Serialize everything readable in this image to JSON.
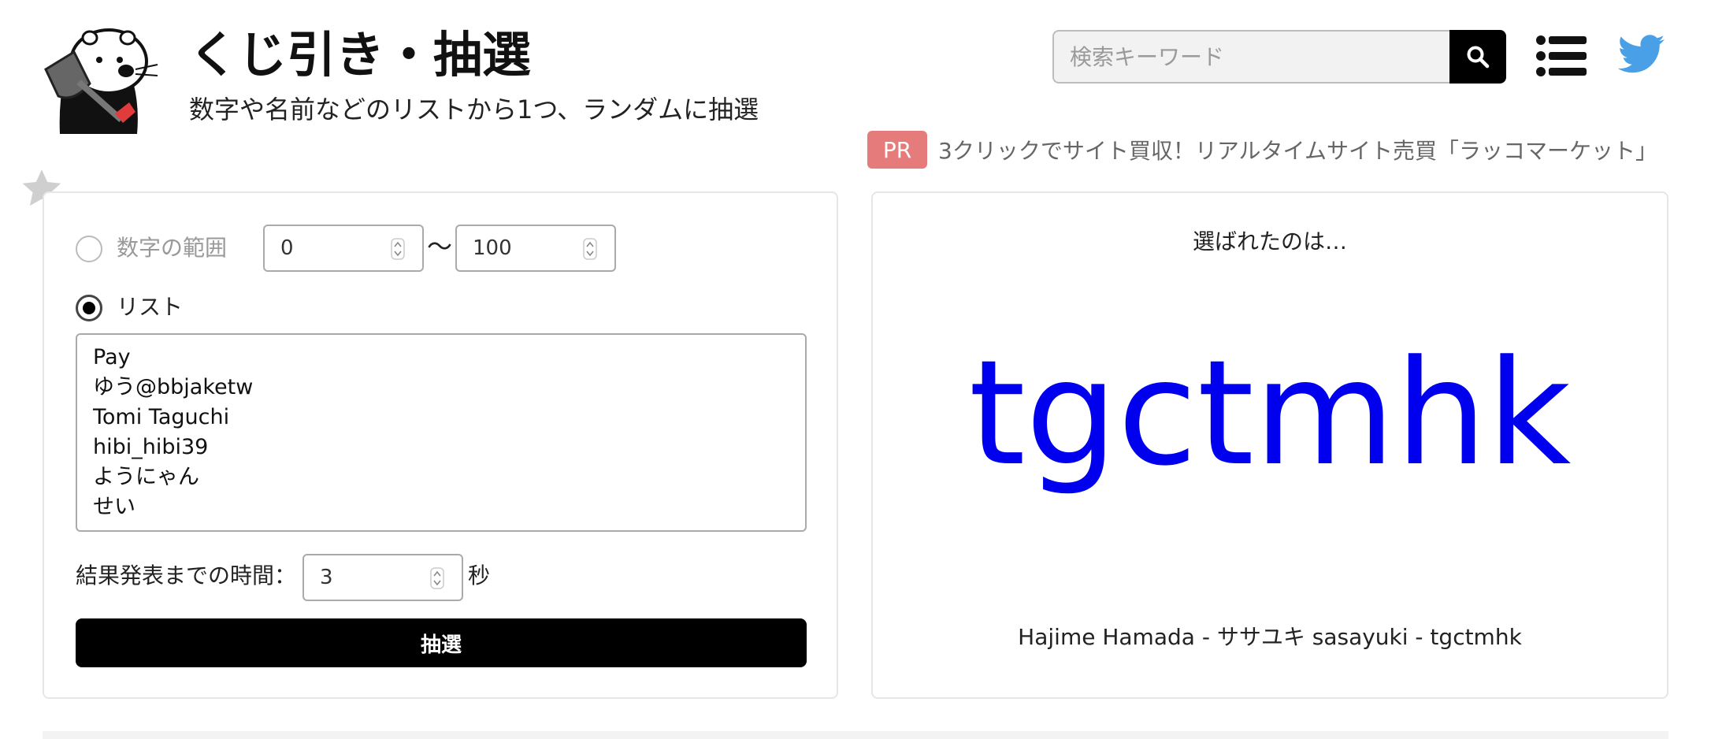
{
  "header": {
    "title": "くじ引き・抽選",
    "subtitle": "数字や名前などのリストから1つ、ランダムに抽選",
    "logo_icon": "otter-with-shovel-logo"
  },
  "search": {
    "placeholder": "検索キーワード",
    "button_icon": "search-icon"
  },
  "nav": {
    "menu_icon": "list-menu-icon",
    "social_icon": "twitter-icon"
  },
  "pr": {
    "badge": "PR",
    "text": "3クリックでサイト買収！リアルタイムサイト売買「ラッコマーケット」"
  },
  "form": {
    "range_label": "数字の範囲",
    "range_selected": false,
    "range_from": "0",
    "tilde": "〜",
    "range_to": "100",
    "list_label": "リスト",
    "list_selected": true,
    "list_items": [
      "Pay",
      "ゆう@bbjaketw",
      "Tomi Taguchi",
      "hibi_hibi39",
      "ようにゃん",
      "せい"
    ],
    "time_label": "結果発表までの時間：",
    "time_value": "3",
    "time_unit": "秒",
    "draw_button": "抽選"
  },
  "result": {
    "caption": "選ばれたのは…",
    "winner": "tgctmhk",
    "history": "Hajime Hamada - ササユキ sasayuki - tgctmhk"
  },
  "colors": {
    "accent_result": "#0000ee",
    "pr_badge": "#e57b7b",
    "twitter": "#4aa0e6"
  }
}
